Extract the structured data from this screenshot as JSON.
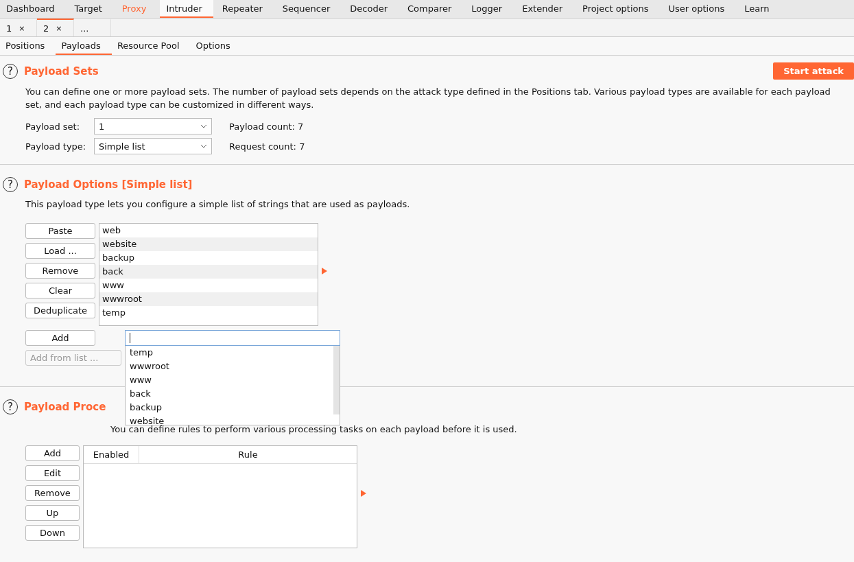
{
  "main_tabs": [
    {
      "label": "Dashboard",
      "selected": false,
      "highlighted": false
    },
    {
      "label": "Target",
      "selected": false,
      "highlighted": false
    },
    {
      "label": "Proxy",
      "selected": false,
      "highlighted": true
    },
    {
      "label": "Intruder",
      "selected": true,
      "highlighted": false
    },
    {
      "label": "Repeater",
      "selected": false,
      "highlighted": false
    },
    {
      "label": "Sequencer",
      "selected": false,
      "highlighted": false
    },
    {
      "label": "Decoder",
      "selected": false,
      "highlighted": false
    },
    {
      "label": "Comparer",
      "selected": false,
      "highlighted": false
    },
    {
      "label": "Logger",
      "selected": false,
      "highlighted": false
    },
    {
      "label": "Extender",
      "selected": false,
      "highlighted": false
    },
    {
      "label": "Project options",
      "selected": false,
      "highlighted": false
    },
    {
      "label": "User options",
      "selected": false,
      "highlighted": false
    },
    {
      "label": "Learn",
      "selected": false,
      "highlighted": false
    }
  ],
  "request_tabs": [
    {
      "label": "1",
      "close": "×",
      "selected": false
    },
    {
      "label": "2",
      "close": "×",
      "selected": true
    },
    {
      "label": "...",
      "selected": false
    }
  ],
  "sub_tabs": [
    {
      "label": "Positions",
      "selected": false
    },
    {
      "label": "Payloads",
      "selected": true
    },
    {
      "label": "Resource Pool",
      "selected": false
    },
    {
      "label": "Options",
      "selected": false
    }
  ],
  "payload_sets": {
    "help": "?",
    "title": "Payload Sets",
    "start_button": "Start attack",
    "description": "You can define one or more payload sets. The number of payload sets depends on the attack type defined in the Positions tab. Various payload types are available for each payload set, and each payload type can be customized in different ways.",
    "fields": [
      {
        "label": "Payload set:",
        "value": "1",
        "info": "Payload count: 7"
      },
      {
        "label": "Payload type:",
        "value": "Simple list",
        "info": "Request count: 7"
      }
    ]
  },
  "payload_options": {
    "help": "?",
    "title": "Payload Options [Simple list]",
    "description": "This payload type lets you configure a simple list of strings that are used as payloads.",
    "buttons": [
      "Paste",
      "Load ...",
      "Remove",
      "Clear",
      "Deduplicate"
    ],
    "list": [
      "web",
      "website",
      "backup",
      "back",
      "www",
      "wwwroot",
      "temp"
    ],
    "add_button": "Add",
    "add_from_list": {
      "label": "Add from list ...",
      "disabled": true
    },
    "suggestions": [
      "temp",
      "wwwroot",
      "www",
      "back",
      "backup",
      "website"
    ]
  },
  "payload_processing": {
    "help": "?",
    "title": "Payload Proce",
    "description": "You can define rules to perform various processing tasks on each payload before it is used.",
    "buttons": [
      "Add",
      "Edit",
      "Remove",
      "Up",
      "Down"
    ],
    "columns": [
      "Enabled",
      "Rule"
    ]
  }
}
